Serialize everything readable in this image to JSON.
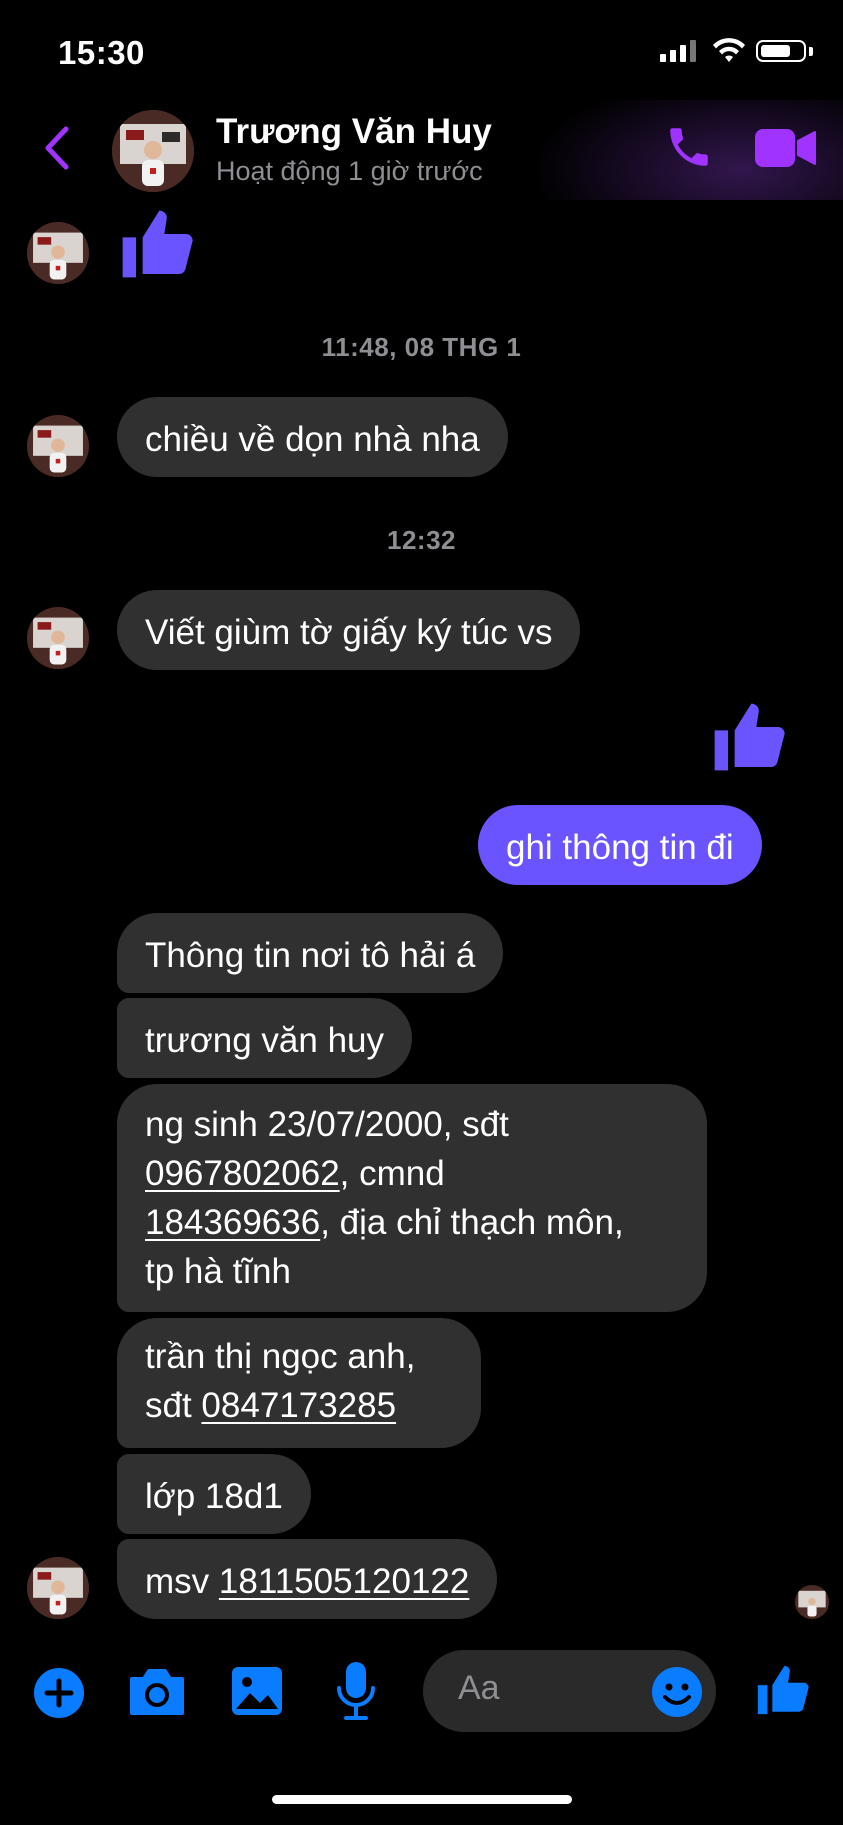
{
  "status_bar": {
    "time": "15:30",
    "battery_level": 0.75
  },
  "header": {
    "contact_name": "Trương Văn Huy",
    "subtitle": "Hoạt động 1 giờ trước",
    "icons": [
      "back-chevron-icon",
      "phone-icon",
      "video-camera-icon"
    ]
  },
  "timestamps": {
    "first": "11:48, 08 THG 1",
    "second": "12:32"
  },
  "messages": {
    "m1": "chiều về dọn nhà nha",
    "m2": "Viết giùm tờ giấy ký túc vs",
    "mine1": "ghi thông tin đi",
    "m3": "Thông tin nơi tô hải á",
    "m4": "trương văn huy",
    "m5": {
      "line1": "ng sinh 23/07/2000, sđt",
      "phone": "0967802062",
      "after_phone": ", cmnd",
      "id_no": "184369636",
      "after_id": ", địa chỉ thạch môn,",
      "line4": "tp hà tĩnh"
    },
    "m6": {
      "line1": "trần thị ngọc anh,",
      "prefix": "sđt ",
      "phone": "0847173285"
    },
    "m7": "lớp 18d1",
    "m8": {
      "prefix": "msv ",
      "number": "1811505120122"
    }
  },
  "composer": {
    "placeholder": "Aa",
    "icons": [
      "plus-icon",
      "camera-icon",
      "gallery-icon",
      "microphone-icon",
      "emoji-icon",
      "thumbs-up-icon"
    ]
  },
  "colors": {
    "accent_purple": "#a033ff",
    "my_bubble": "#6a54ff",
    "their_bubble": "#303030",
    "composer_blue": "#0a7cff",
    "secondary_text": "#8e8e93"
  }
}
